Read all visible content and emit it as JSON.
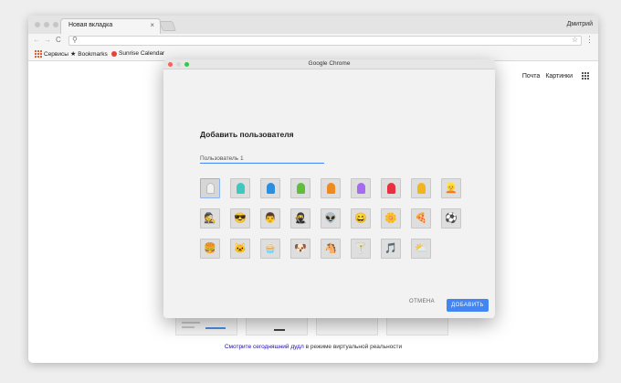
{
  "browser": {
    "tab_title": "Новая вкладка",
    "tab_close": "×",
    "profile_name": "Дмитрий",
    "back": "←",
    "forward": "→",
    "reload": "C",
    "omnibox_value": "",
    "bookmarks": {
      "apps": "Сервисы",
      "bookmarks": "Bookmarks",
      "sunrise": "Sunrise Calendar"
    },
    "top_links": {
      "mail": "Почта",
      "images": "Картинки"
    },
    "doodle_link": "Смотрите сегодняшний дудл",
    "doodle_text": " в режиме виртуальной реальности"
  },
  "dialog": {
    "title": "Google Chrome",
    "heading": "Добавить пользователя",
    "name_value": "Пользователь 1",
    "cancel_label": "ОТМЕНА",
    "add_label": "ДОБАВИТЬ",
    "avatars": [
      {
        "name": "avatar-white-head-icon",
        "color": "#f0f0f0",
        "glyph": ""
      },
      {
        "name": "avatar-teal-head-icon",
        "color": "#3fc8c0",
        "glyph": ""
      },
      {
        "name": "avatar-blue-head-icon",
        "color": "#2a8fe0",
        "glyph": ""
      },
      {
        "name": "avatar-green-head-icon",
        "color": "#5fbf3a",
        "glyph": ""
      },
      {
        "name": "avatar-orange-head-icon",
        "color": "#f08a1e",
        "glyph": ""
      },
      {
        "name": "avatar-purple-head-icon",
        "color": "#a66bf0",
        "glyph": ""
      },
      {
        "name": "avatar-red-head-icon",
        "color": "#e83040",
        "glyph": ""
      },
      {
        "name": "avatar-yellow-head-icon",
        "color": "#f2b51c",
        "glyph": ""
      },
      {
        "name": "avatar-ninja-girl-icon",
        "color": "",
        "glyph": "👱"
      },
      {
        "name": "avatar-businessman-icon",
        "color": "",
        "glyph": "🕵"
      },
      {
        "name": "avatar-sunglasses-man-icon",
        "color": "",
        "glyph": "😎"
      },
      {
        "name": "avatar-man-icon",
        "color": "",
        "glyph": "👨"
      },
      {
        "name": "avatar-ninja-icon",
        "color": "",
        "glyph": "🥷"
      },
      {
        "name": "avatar-alien-icon",
        "color": "",
        "glyph": "👽"
      },
      {
        "name": "avatar-smiley-icon",
        "color": "",
        "glyph": "😄"
      },
      {
        "name": "avatar-flower-icon",
        "color": "",
        "glyph": "🌼"
      },
      {
        "name": "avatar-pizza-icon",
        "color": "",
        "glyph": "🍕"
      },
      {
        "name": "avatar-soccer-ball-icon",
        "color": "",
        "glyph": "⚽"
      },
      {
        "name": "avatar-burger-icon",
        "color": "",
        "glyph": "🍔"
      },
      {
        "name": "avatar-cat-icon",
        "color": "",
        "glyph": "🐱"
      },
      {
        "name": "avatar-cupcake-icon",
        "color": "",
        "glyph": "🧁"
      },
      {
        "name": "avatar-dog-icon",
        "color": "",
        "glyph": "🐶"
      },
      {
        "name": "avatar-horse-icon",
        "color": "",
        "glyph": "🐴"
      },
      {
        "name": "avatar-cocktail-icon",
        "color": "",
        "glyph": "🍸"
      },
      {
        "name": "avatar-music-note-icon",
        "color": "",
        "glyph": "🎵"
      },
      {
        "name": "avatar-sun-cloud-icon",
        "color": "",
        "glyph": "⛅"
      }
    ]
  }
}
